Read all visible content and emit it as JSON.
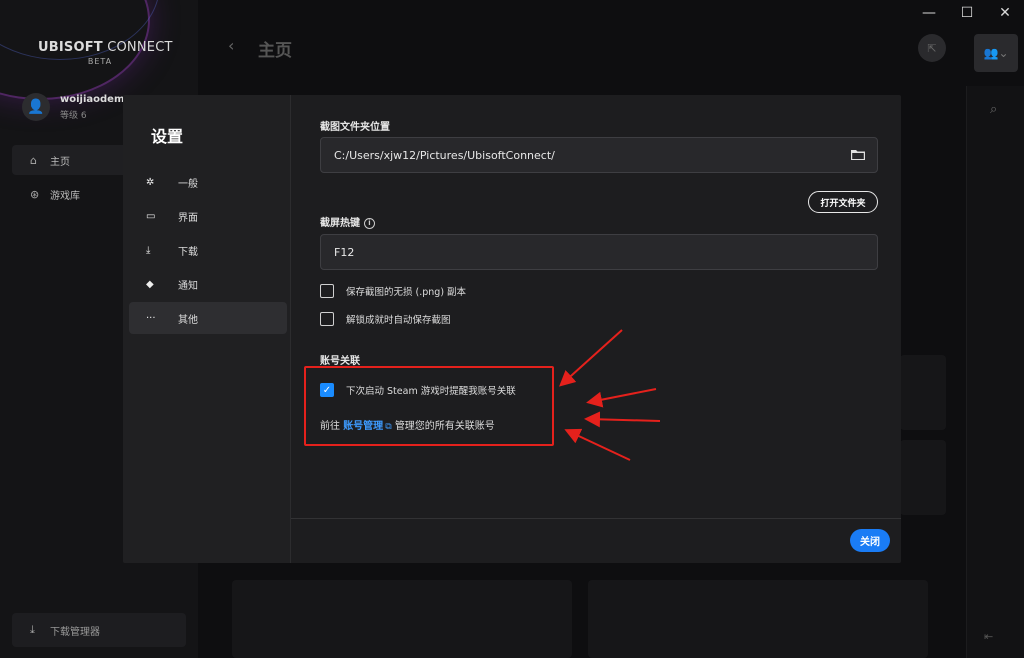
{
  "window": {
    "minimize": "—",
    "maximize": "☐",
    "close": "✕"
  },
  "sidebar": {
    "logo_bold": "UBISOFT",
    "logo_light": "CONNECT",
    "logo_sub": "BETA",
    "username": "woijiaodema",
    "level": "等级 6",
    "nav": [
      {
        "label": "主页",
        "icon": "home-icon"
      },
      {
        "label": "游戏库",
        "icon": "gamepad-icon"
      }
    ],
    "download_manager": "下载管理器"
  },
  "main": {
    "title": "主页"
  },
  "settings": {
    "title": "设置",
    "menu": [
      {
        "label": "一般",
        "icon": "gear-icon",
        "glyph": "✲"
      },
      {
        "label": "界面",
        "icon": "monitor-icon",
        "glyph": "▭"
      },
      {
        "label": "下载",
        "icon": "download-icon",
        "glyph": "⤓"
      },
      {
        "label": "通知",
        "icon": "bell-icon",
        "glyph": "◆"
      },
      {
        "label": "其他",
        "icon": "more-icon",
        "glyph": "···"
      }
    ],
    "active_menu": "其他",
    "screenshot_folder_label": "截图文件夹位置",
    "screenshot_folder_value": "C:/Users/xjw12/Pictures/UbisoftConnect/",
    "open_folder_button": "打开文件夹",
    "hotkey_label": "截屏热键",
    "hotkey_value": "F12",
    "save_png_label": "保存截图的无损 (.png) 副本",
    "save_png_checked": false,
    "auto_save_label": "解锁成就时自动保存截图",
    "auto_save_checked": false,
    "account_link_header": "账号关联",
    "steam_remind_label": "下次启动 Steam 游戏时提醒我账号关联",
    "steam_remind_checked": true,
    "manage_prefix": "前往",
    "manage_link": "账号管理",
    "manage_suffix": "管理您的所有关联账号",
    "close_button": "关闭"
  },
  "colors": {
    "accent": "#1a7cf5",
    "link": "#3d9bff",
    "annotation": "#e5211c"
  }
}
